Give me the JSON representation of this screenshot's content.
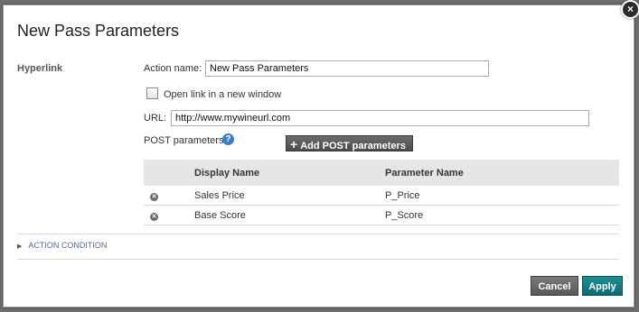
{
  "dialog": {
    "title": "New Pass Parameters",
    "section_label": "Hyperlink",
    "action_name_label": "Action name:",
    "action_name_value": "New Pass Parameters",
    "open_new_window_label": "Open link in a new window",
    "url_label": "URL:",
    "url_value": "http://www.mywineurl.com",
    "post_params_label": "POST parameters:",
    "help_glyph": "?",
    "add_post_button_label": "Add POST parameters",
    "add_post_glyph": "+",
    "table": {
      "headers": [
        "Display Name",
        "Parameter Name"
      ],
      "rows": [
        {
          "display_name": "Sales Price",
          "parameter_name": "P_Price"
        },
        {
          "display_name": "Base Score",
          "parameter_name": "P_Score"
        }
      ]
    },
    "action_condition_label": "ACTION CONDITION",
    "cancel_label": "Cancel",
    "apply_label": "Apply",
    "close_glyph": "×"
  }
}
